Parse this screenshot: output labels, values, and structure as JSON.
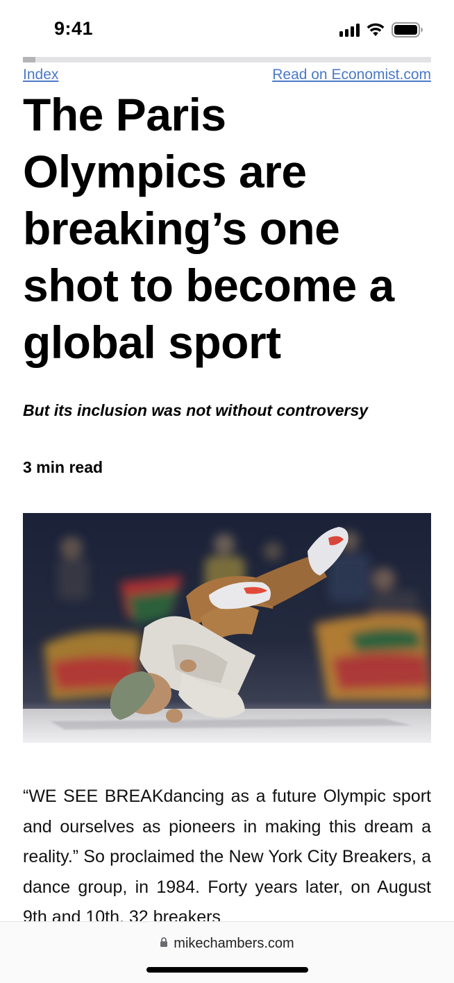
{
  "status_bar": {
    "time": "9:41",
    "icons": [
      "signal-icon",
      "wifi-icon",
      "battery-icon"
    ]
  },
  "reading_progress": 0.03,
  "nav": {
    "index_label": "Index",
    "source_label": "Read on Economist.com"
  },
  "article": {
    "headline": "The Paris Olympics are breaking’s one shot to become a global sport",
    "subtitle": "But its inclusion was not without controversy",
    "read_time": "3 min read",
    "image_description_icon": "breakdancer-photo",
    "body": "“WE SEE BREAKdancing as a future Olympic sport and ourselves as pioneers in making this dream a reality.” So proclaimed the New York City Breakers, a dance group, in 1984. Forty years later, on August 9th and 10th, 32 breakers"
  },
  "browser": {
    "url": "mikechambers.com",
    "lock_icon": "lock-icon"
  },
  "colors": {
    "link": "#4a78c8",
    "progress_track": "#e3e3e6",
    "progress_fill": "#b4b4b8"
  }
}
